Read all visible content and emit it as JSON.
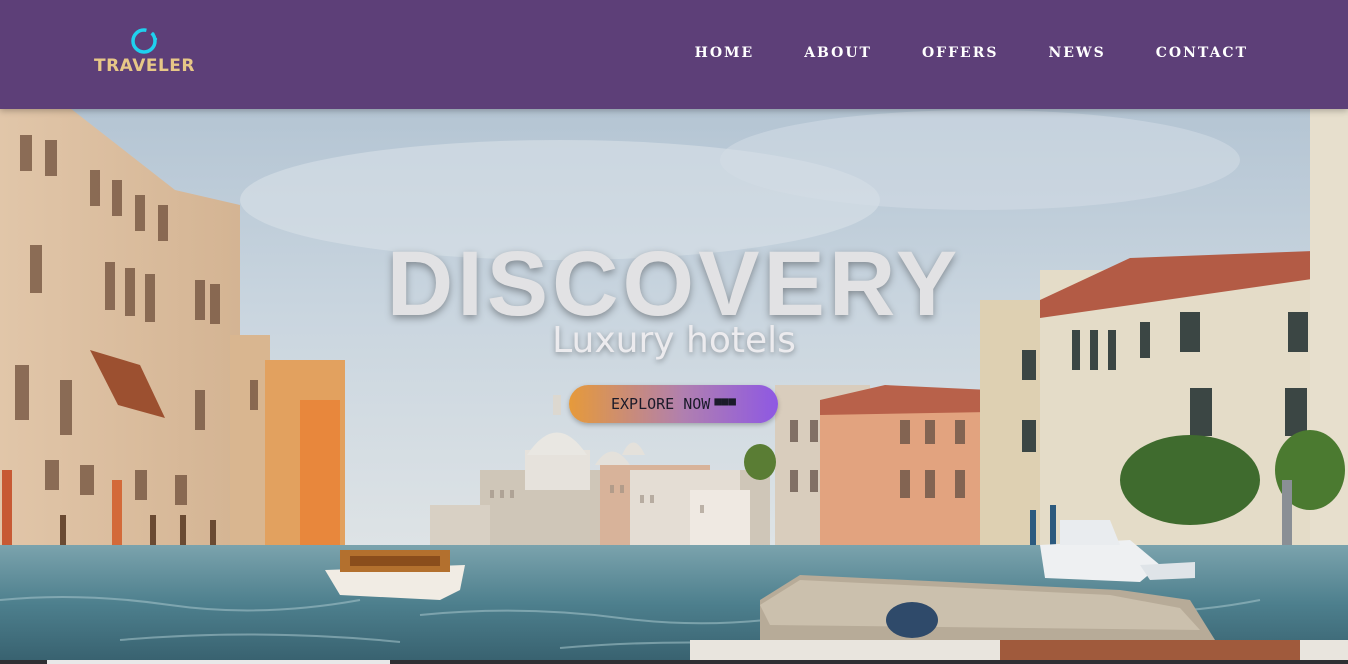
{
  "brand": {
    "name": "TRAVELER",
    "logo_icon": "ring-icon",
    "logo_color": "#1fd1ee",
    "text_color": "#e7c787"
  },
  "nav": {
    "background": "#5d3f78",
    "links": [
      "HOME",
      "ABOUT",
      "OFFERS",
      "NEWS",
      "CONTACT"
    ]
  },
  "hero": {
    "title": "DISCOVERY",
    "subtitle": "Luxury hotels",
    "cta_label": "EXPLORE NOW",
    "cta_icon": "dots-icon",
    "cta_gradient": [
      "#e69a3a",
      "#8e58e3"
    ],
    "background_image": "venice-canal-scene"
  }
}
